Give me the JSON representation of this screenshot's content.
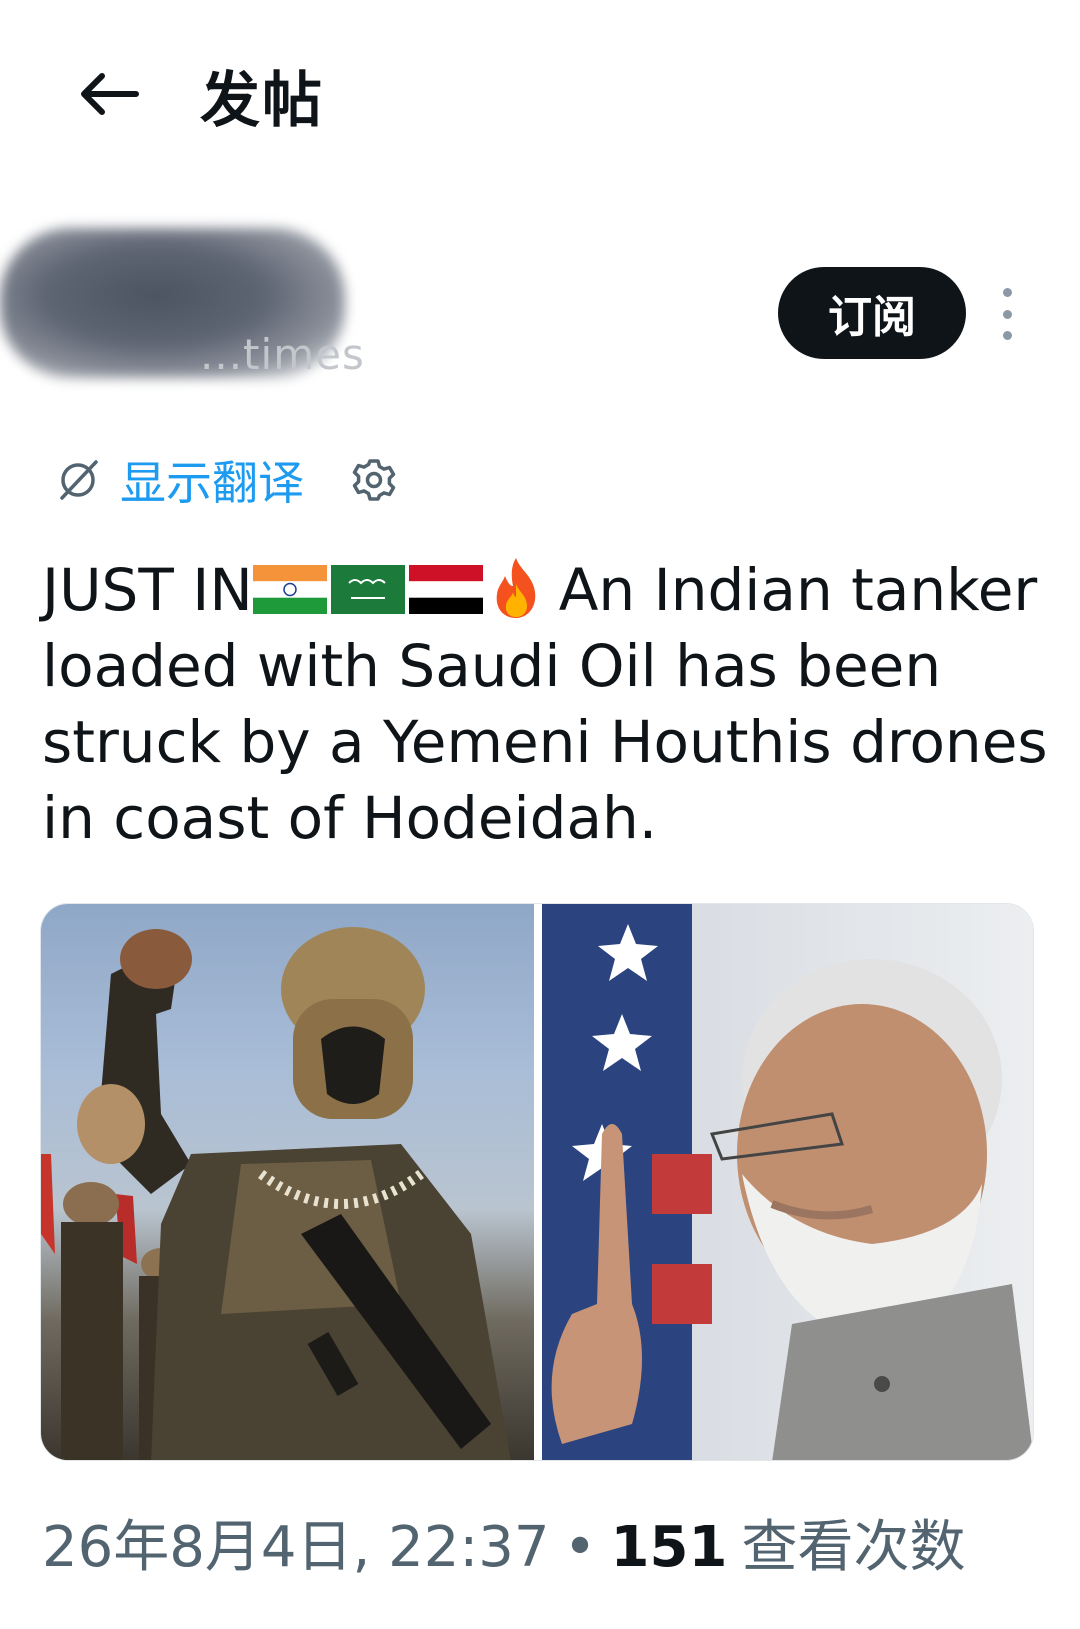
{
  "header": {
    "title": "发帖",
    "back_icon": "arrow-left-icon"
  },
  "author": {
    "handle_visible": "...times",
    "subscribe_label": "订阅",
    "more_icon": "vertical-ellipsis-icon"
  },
  "translation": {
    "label": "显示翻译",
    "icon": "globe-slash-icon",
    "settings_icon": "gear-icon",
    "color": "#1d9bf0"
  },
  "post": {
    "prefix": "JUST IN",
    "flags": [
      "india-flag",
      "saudi-arabia-flag",
      "yemen-flag"
    ],
    "emoji": "fire",
    "text": "An Indian tanker loaded with Saudi Oil has been struck by a Yemeni Houthis drones in coast of Hodeidah."
  },
  "media": [
    {
      "name": "soldier-photo"
    },
    {
      "name": "politician-photo"
    }
  ],
  "meta": {
    "datetime": "26年8月4日, 22:37",
    "separator": "•",
    "views": "151",
    "views_label": "查看次数"
  },
  "colors": {
    "accent": "#1d9bf0",
    "text": "#0f1419",
    "muted": "#536471",
    "button_bg": "#0f1419"
  }
}
